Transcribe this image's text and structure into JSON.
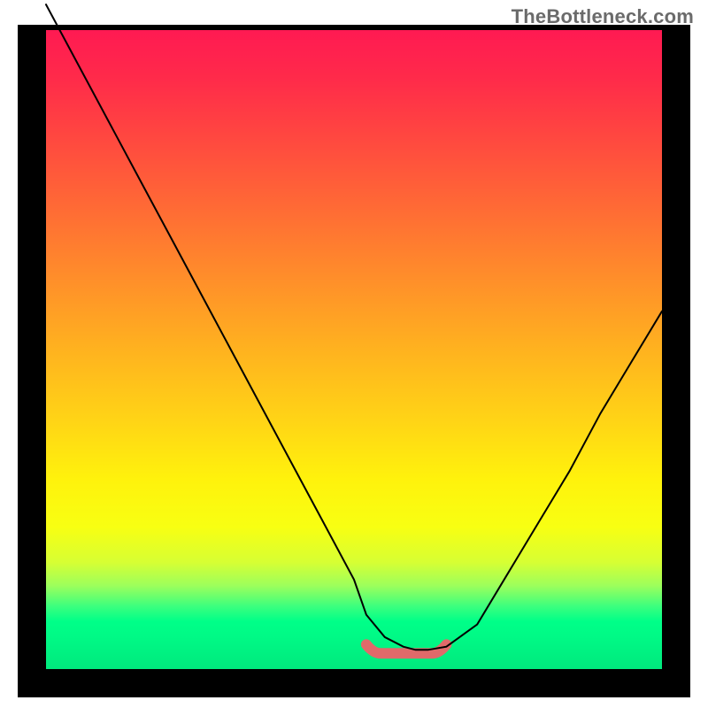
{
  "watermark": "TheBottleneck.com",
  "colors": {
    "frame": "#000000",
    "gradient_top": "#ff1a52",
    "gradient_mid": "#ffd416",
    "gradient_bottom_green": "#00ff88",
    "curve": "#000000",
    "flat_highlight": "#e06a6a"
  },
  "chart_data": {
    "type": "line",
    "title": "",
    "xlabel": "",
    "ylabel": "",
    "xlim": [
      0,
      100
    ],
    "ylim": [
      0,
      100
    ],
    "x": [
      0,
      5,
      10,
      15,
      20,
      25,
      30,
      35,
      40,
      45,
      50,
      52,
      55,
      58,
      60,
      62,
      65,
      70,
      75,
      80,
      85,
      90,
      95,
      100
    ],
    "values": [
      104,
      95,
      86,
      77,
      68,
      59,
      50,
      41,
      32,
      23,
      14,
      8.5,
      5,
      3.5,
      3,
      3,
      3.5,
      7,
      15,
      23,
      31,
      40,
      48,
      56
    ],
    "annotations": [
      {
        "type": "flat-segment",
        "x_start": 52,
        "x_end": 65,
        "y": 3,
        "color": "#e06a6a"
      }
    ],
    "background": "vertical-heat-gradient"
  }
}
